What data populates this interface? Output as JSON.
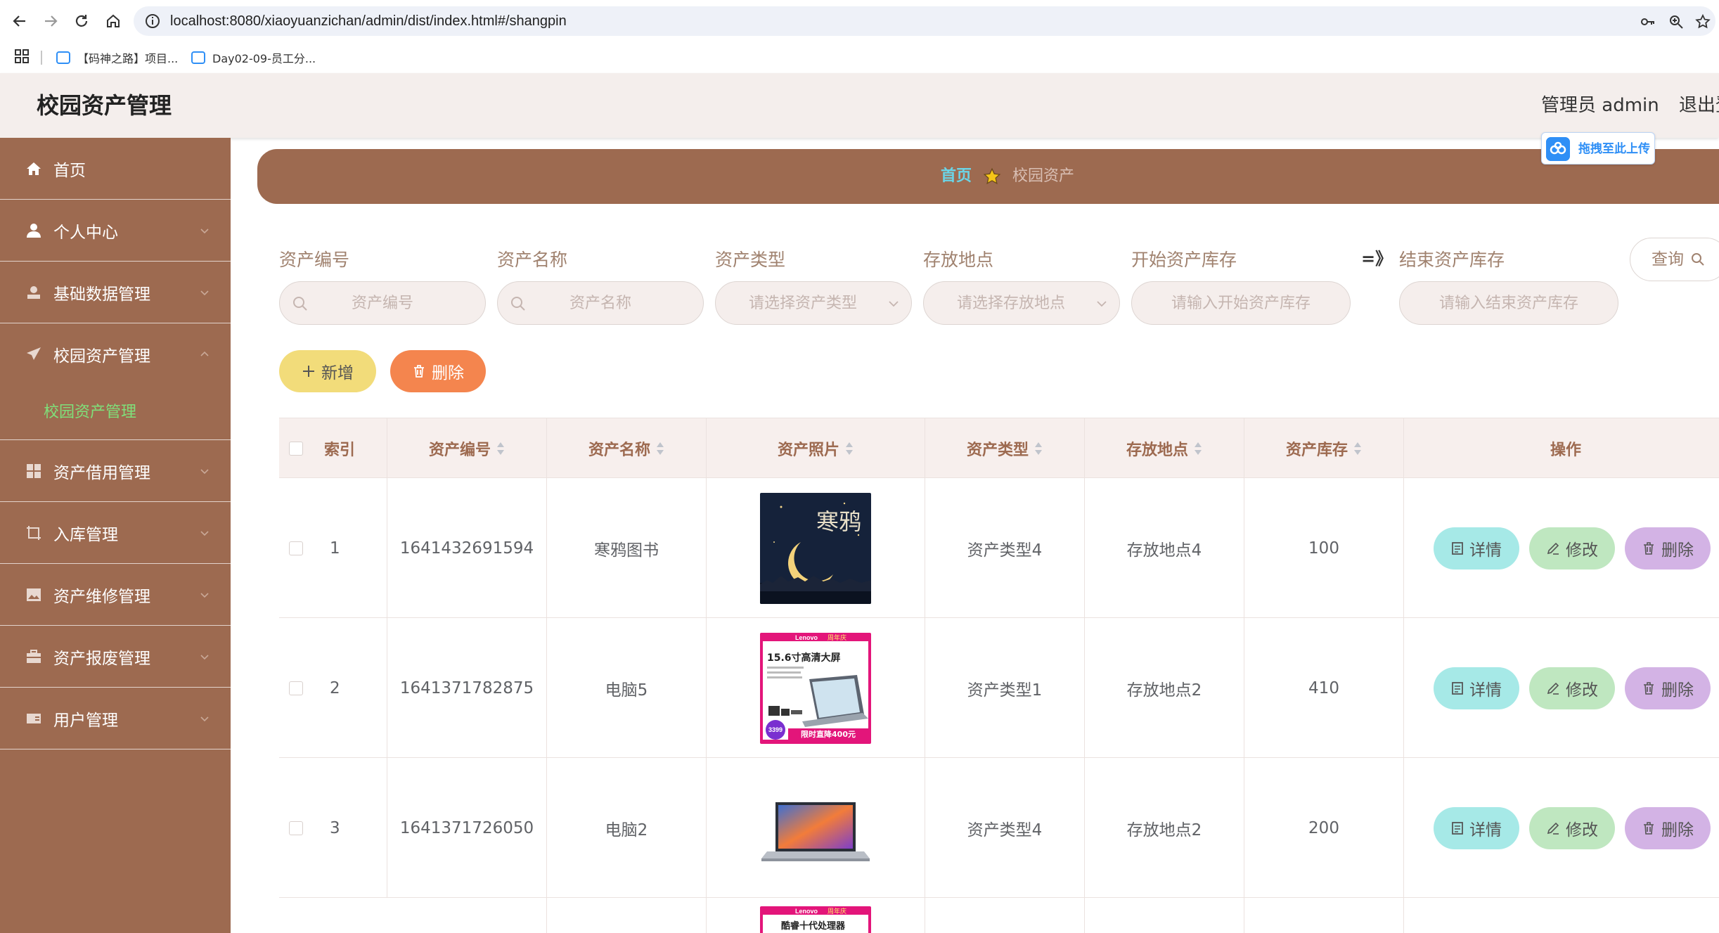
{
  "browser": {
    "url": "localhost:8080/xiaoyuanzichan/admin/dist/index.html#/shangpin",
    "bookmarks": [
      "【码神之路】项目...",
      "Day02-09-员工分..."
    ]
  },
  "header": {
    "title": "校园资产管理",
    "admin": "管理员 admin",
    "logout": "退出登"
  },
  "upload_badge": "拖拽至此上传",
  "sidebar": {
    "items": [
      {
        "label": "首页",
        "icon": "home-icon"
      },
      {
        "label": "个人中心",
        "icon": "user-icon"
      },
      {
        "label": "基础数据管理",
        "icon": "person-icon"
      },
      {
        "label": "校园资产管理",
        "icon": "send-icon"
      },
      {
        "label": "资产借用管理",
        "icon": "grid-icon"
      },
      {
        "label": "入库管理",
        "icon": "crop-icon"
      },
      {
        "label": "资产维修管理",
        "icon": "picture-icon"
      },
      {
        "label": "资产报废管理",
        "icon": "suitcase-icon"
      },
      {
        "label": "用户管理",
        "icon": "card-icon"
      }
    ],
    "sub_item": "校园资产管理"
  },
  "breadcrumb": {
    "home": "首页",
    "current": "校园资产"
  },
  "filters": {
    "code_label": "资产编号",
    "code_placeholder": "资产编号",
    "name_label": "资产名称",
    "name_placeholder": "资产名称",
    "type_label": "资产类型",
    "type_placeholder": "请选择资产类型",
    "location_label": "存放地点",
    "location_placeholder": "请选择存放地点",
    "stock_start_label": "开始资产库存",
    "stock_start_placeholder": "请输入开始资产库存",
    "range_sign": "=》",
    "stock_end_label": "结束资产库存",
    "stock_end_placeholder": "请输入结束资产库存",
    "query": "查询"
  },
  "actions": {
    "add": "新增",
    "delete": "删除"
  },
  "table": {
    "headers": {
      "index": "索引",
      "code": "资产编号",
      "name": "资产名称",
      "photo": "资产照片",
      "type": "资产类型",
      "location": "存放地点",
      "stock": "资产库存",
      "ops": "操作"
    },
    "op_labels": {
      "detail": "详情",
      "edit": "修改",
      "delete": "删除"
    },
    "rows": [
      {
        "index": "1",
        "code": "1641432691594",
        "name": "寒鸦图书",
        "photo_text": "寒鸦",
        "type": "资产类型4",
        "location": "存放地点4",
        "stock": "100"
      },
      {
        "index": "2",
        "code": "1641371782875",
        "name": "电脑5",
        "photo_brand": "Lenovo",
        "photo_tag": "周年庆",
        "photo_line1": "15.6寸高清大屏",
        "photo_price": "3399",
        "photo_promo": "限时直降400元",
        "type": "资产类型1",
        "location": "存放地点2",
        "stock": "410"
      },
      {
        "index": "3",
        "code": "1641371726050",
        "name": "电脑2",
        "type": "资产类型4",
        "location": "存放地点2",
        "stock": "200"
      },
      {
        "photo_brand": "Lenovo",
        "photo_tag": "周年庆",
        "photo_line1": "酷睿十代处理器"
      }
    ]
  }
}
